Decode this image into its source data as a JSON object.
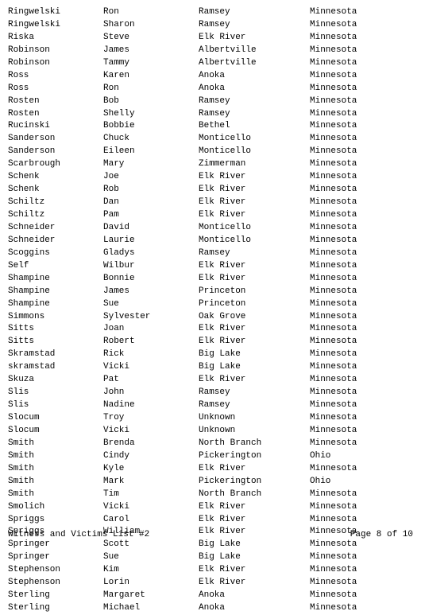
{
  "rows": [
    [
      "Ringwelski",
      "Ron",
      "Ramsey",
      "Minnesota"
    ],
    [
      "Ringwelski",
      "Sharon",
      "Ramsey",
      "Minnesota"
    ],
    [
      "Riska",
      "Steve",
      "Elk River",
      "Minnesota"
    ],
    [
      "Robinson",
      "James",
      "Albertville",
      "Minnesota"
    ],
    [
      "Robinson",
      "Tammy",
      "Albertville",
      "Minnesota"
    ],
    [
      "Ross",
      "Karen",
      "Anoka",
      "Minnesota"
    ],
    [
      "Ross",
      "Ron",
      "Anoka",
      "Minnesota"
    ],
    [
      "Rosten",
      "Bob",
      "Ramsey",
      "Minnesota"
    ],
    [
      "Rosten",
      "Shelly",
      "Ramsey",
      "Minnesota"
    ],
    [
      "Rucinski",
      "Bobbie",
      "Bethel",
      "Minnesota"
    ],
    [
      "Sanderson",
      "Chuck",
      "Monticello",
      "Minnesota"
    ],
    [
      "Sanderson",
      "Eileen",
      "Monticello",
      "Minnesota"
    ],
    [
      "Scarbrough",
      "Mary",
      "Zimmerman",
      "Minnesota"
    ],
    [
      "Schenk",
      "Joe",
      "Elk River",
      "Minnesota"
    ],
    [
      "Schenk",
      "Rob",
      "Elk River",
      "Minnesota"
    ],
    [
      "Schiltz",
      "Dan",
      "Elk River",
      "Minnesota"
    ],
    [
      "Schiltz",
      "Pam",
      "Elk River",
      "Minnesota"
    ],
    [
      "Schneider",
      "David",
      "Monticello",
      "Minnesota"
    ],
    [
      "Schneider",
      "Laurie",
      "Monticello",
      "Minnesota"
    ],
    [
      "Scoggins",
      "Gladys",
      "Ramsey",
      "Minnesota"
    ],
    [
      "Self",
      "Wilbur",
      "Elk River",
      "Minnesota"
    ],
    [
      "Shampine",
      "Bonnie",
      "Elk River",
      "Minnesota"
    ],
    [
      "Shampine",
      "James",
      "Princeton",
      "Minnesota"
    ],
    [
      "Shampine",
      "Sue",
      "Princeton",
      "Minnesota"
    ],
    [
      "Simmons",
      "Sylvester",
      "Oak Grove",
      "Minnesota"
    ],
    [
      "Sitts",
      "Joan",
      "Elk River",
      "Minnesota"
    ],
    [
      "Sitts",
      "Robert",
      "Elk River",
      "Minnesota"
    ],
    [
      "Skramstad",
      "Rick",
      "Big Lake",
      "Minnesota"
    ],
    [
      "skramstad",
      "Vicki",
      "Big Lake",
      "Minnesota"
    ],
    [
      "Skuza",
      "Pat",
      "Elk River",
      "Minnesota"
    ],
    [
      "Slis",
      "John",
      "Ramsey",
      "Minnesota"
    ],
    [
      "Slis",
      "Nadine",
      "Ramsey",
      "Minnesota"
    ],
    [
      "Slocum",
      "Troy",
      "Unknown",
      "Minnesota"
    ],
    [
      "Slocum",
      "Vicki",
      "Unknown",
      "Minnesota"
    ],
    [
      "Smith",
      "Brenda",
      "North Branch",
      "Minnesota"
    ],
    [
      "Smith",
      "Cindy",
      "Pickerington",
      "Ohio"
    ],
    [
      "Smith",
      "Kyle",
      "Elk River",
      "Minnesota"
    ],
    [
      "Smith",
      "Mark",
      "Pickerington",
      "Ohio"
    ],
    [
      "Smith",
      "Tim",
      "North Branch",
      "Minnesota"
    ],
    [
      "Smolich",
      "Vicki",
      "Elk River",
      "Minnesota"
    ],
    [
      "Spriggs",
      "Carol",
      "Elk River",
      "Minnesota"
    ],
    [
      "Spriggs",
      "William",
      "Elk River",
      "Minnesota"
    ],
    [
      "Springer",
      "Scott",
      "Big Lake",
      "Minnesota"
    ],
    [
      "Springer",
      "Sue",
      "Big Lake",
      "Minnesota"
    ],
    [
      "Stephenson",
      "Kim",
      "Elk River",
      "Minnesota"
    ],
    [
      "Stephenson",
      "Lorin",
      "Elk River",
      "Minnesota"
    ],
    [
      "Sterling",
      "Margaret",
      "Anoka",
      "Minnesota"
    ],
    [
      "Sterling",
      "Michael",
      "Anoka",
      "Minnesota"
    ]
  ],
  "footer": {
    "left": "Witness and Victims List #2",
    "right": "Page 8 of 10"
  }
}
